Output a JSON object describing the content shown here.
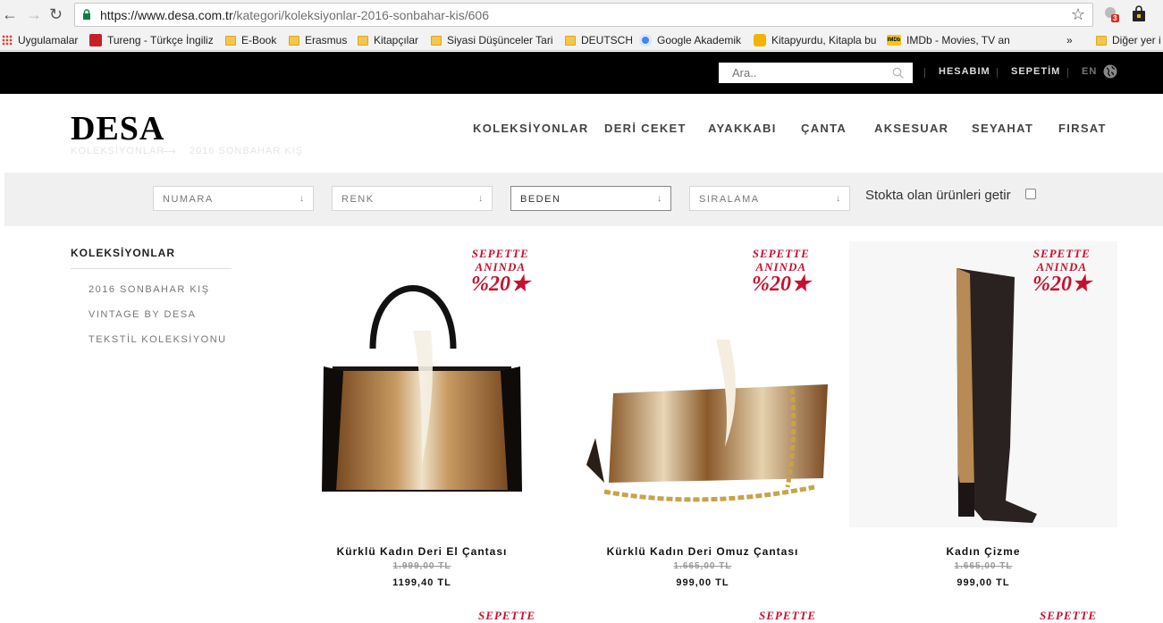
{
  "browser": {
    "url_host": "https://www.desa.com.tr",
    "url_path": "/kategori/koleksiyonlar-2016-sonbahar-kis/606",
    "extension_badge": "3",
    "bookmarks": [
      "Uygulamalar",
      "Tureng - Türkçe İngiliz",
      "E-Book",
      "Erasmus",
      "Kitapçılar",
      "Siyasi Düşünceler Tari",
      "DEUTSCH",
      "Google Akademik",
      "Kitapyurdu, Kitapla bu",
      "IMDb - Movies, TV an"
    ],
    "more": "»",
    "other_bookmarks": "Diğer yer i"
  },
  "topbar": {
    "search_placeholder": "Ara..",
    "account": "HESABIM",
    "cart": "SEPETİM",
    "language": "EN"
  },
  "header": {
    "logo": "DESA",
    "nav": [
      "KOLEKSİYONLAR",
      "DERİ CEKET",
      "AYAKKABI",
      "ÇANTA",
      "AKSESUAR",
      "SEYAHAT",
      "FIRSAT"
    ],
    "breadcrumb": [
      "KOLEKSİYONLAR",
      "2016 SONBAHAR KIŞ"
    ],
    "breadcrumb_sep": "⟶"
  },
  "filters": {
    "selects": [
      "NUMARA",
      "RENK",
      "BEDEN",
      "SIRALAMA"
    ],
    "stock_label": "Stokta olan ürünleri getir"
  },
  "sidebar": {
    "title": "KOLEKSİYONLAR",
    "items": [
      "2016 SONBAHAR KIŞ",
      "VINTAGE BY DESA",
      "TEKSTİL KOLEKSİYONU"
    ]
  },
  "badge": {
    "line1": "SEPETTE",
    "line2": "ANINDA",
    "discount": "%20"
  },
  "products": [
    {
      "name": "Kürklü Kadın Deri El Çantası",
      "old_price": "1.999,00 TL",
      "price": "1199,40 TL"
    },
    {
      "name": "Kürklü Kadın Deri Omuz Çantası",
      "old_price": "1.665,00 TL",
      "price": "999,00 TL"
    },
    {
      "name": "Kadın Çizme",
      "old_price": "1.665,00 TL",
      "price": "999,00 TL"
    }
  ],
  "colors": {
    "discount_red": "#c8102e",
    "topbar": "#000000",
    "filter_bar": "#f0f0f0"
  }
}
